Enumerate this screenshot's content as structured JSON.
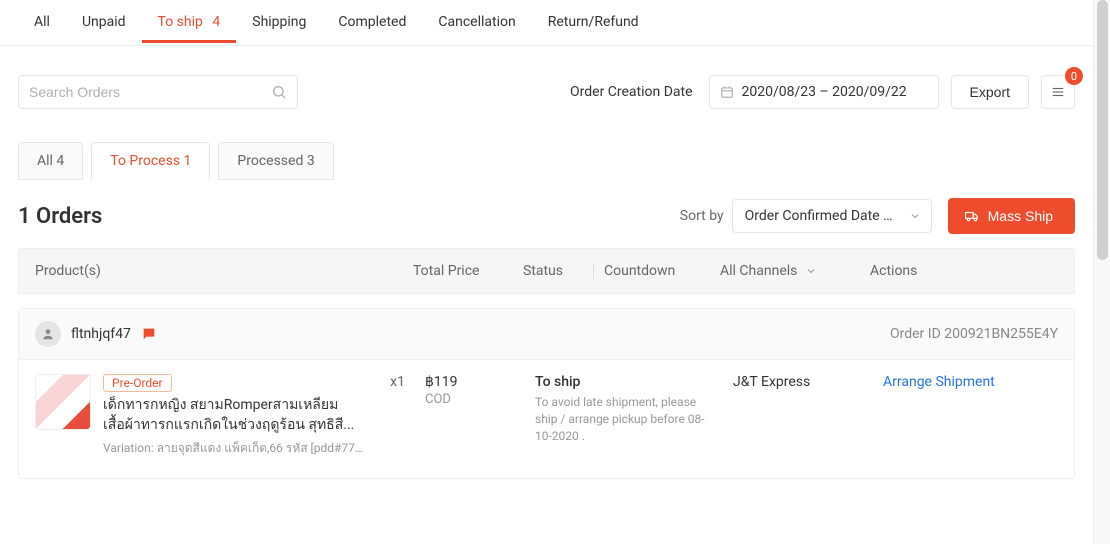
{
  "top_tabs": {
    "all": "All",
    "unpaid": "Unpaid",
    "to_ship": "To ship",
    "to_ship_count": "4",
    "shipping": "Shipping",
    "completed": "Completed",
    "cancellation": "Cancellation",
    "return_refund": "Return/Refund"
  },
  "search": {
    "placeholder": "Search Orders"
  },
  "filter": {
    "date_label": "Order Creation Date",
    "date_range": "2020/08/23 – 2020/09/22",
    "export": "Export",
    "badge": "0"
  },
  "sub_tabs": {
    "all": "All 4",
    "to_process": "To Process 1",
    "processed": "Processed 3"
  },
  "heading": "1 Orders",
  "sort": {
    "label": "Sort by",
    "selected": "Order Confirmed Date -..."
  },
  "mass_ship": "Mass Ship",
  "table": {
    "products": "Product(s)",
    "total_price": "Total Price",
    "status": "Status",
    "countdown": "Countdown",
    "all_channels": "All Channels",
    "actions": "Actions"
  },
  "order": {
    "username": "fltnhjqf47",
    "order_id_label": "Order ID 200921BN255E4Y",
    "preorder": "Pre-Order",
    "product_name": "เด็กทารกหญิง สยามRomperสามเหลี่ยม เสื้อผ้าทารกแรกเกิดในช่วงฤดูร้อน สุทธิสี...",
    "variation": "Variation: ลายจุดสีแดง แพ็คเก็ต,66 รหัส [pdd#771...",
    "qty": "x1",
    "price": "฿119",
    "pay_method": "COD",
    "status": "To ship",
    "status_note": "To avoid late shipment, please ship / arrange pickup before 08-10-2020 .",
    "channel": "J&T Express",
    "action": "Arrange Shipment"
  }
}
